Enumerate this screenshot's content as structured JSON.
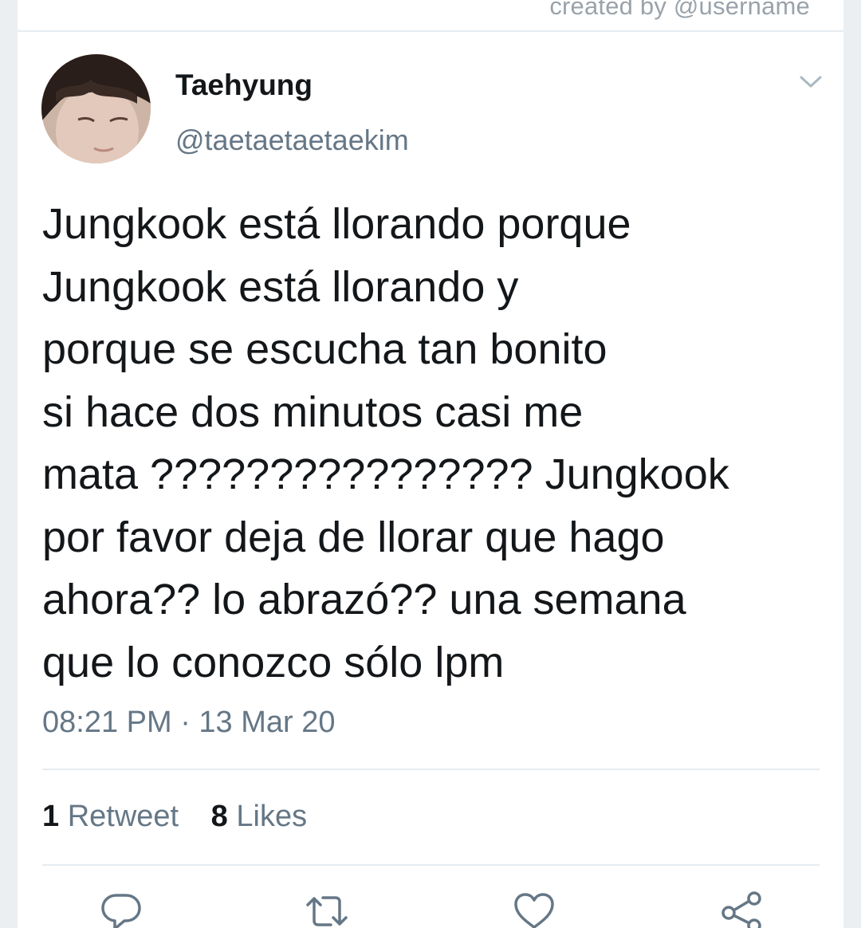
{
  "watermark": "created by @username",
  "tweet": {
    "display_name": "Taehyung",
    "handle": "@taetaetaetaekim",
    "text": "Jungkook está llorando porque\nJungkook está llorando y\nporque se escucha tan bonito\nsi hace dos minutos casi me\nmata ???????????????? Jungkook\npor favor deja de llorar que hago\nahora?? lo abrazó?? una semana\nque lo conozco sólo lpm",
    "timestamp": "08:21 PM · 13 Mar 20",
    "stats": {
      "retweets_count": "1",
      "retweets_label": "Retweet",
      "likes_count": "8",
      "likes_label": "Likes"
    }
  },
  "actions": [
    {
      "icon": "reply-icon"
    },
    {
      "icon": "retweet-icon"
    },
    {
      "icon": "like-icon"
    },
    {
      "icon": "share-icon"
    }
  ],
  "colors": {
    "text_primary": "#14171a",
    "text_secondary": "#657786",
    "divider": "#e6ecf0",
    "background": "#ffffff"
  }
}
